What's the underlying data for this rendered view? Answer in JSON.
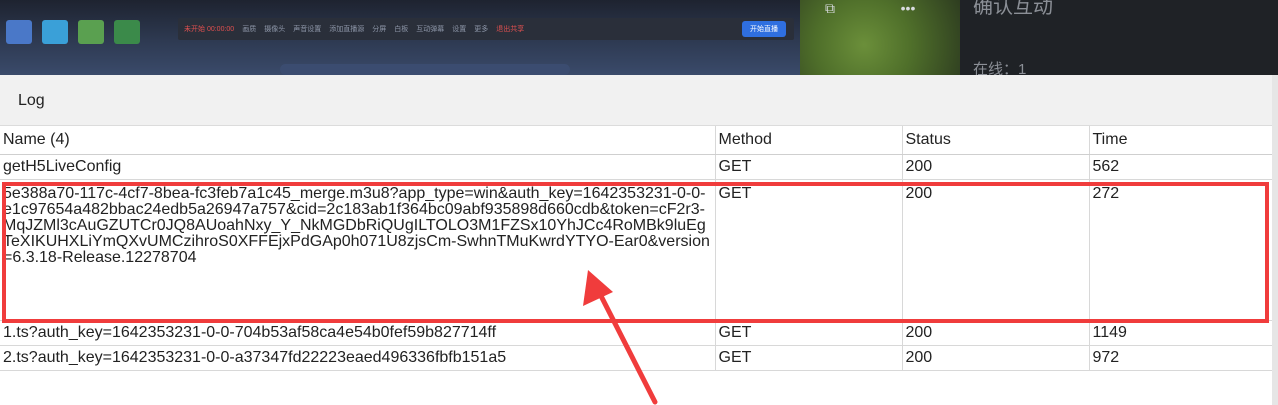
{
  "log_panel": {
    "title": "Log",
    "columns": [
      "Name (4)",
      "Method",
      "Status",
      "Time"
    ],
    "rows": [
      {
        "name": "getH5LiveConfig",
        "method": "GET",
        "status": "200",
        "time": "562"
      },
      {
        "name": "5e388a70-117c-4cf7-8bea-fc3feb7a1c45_merge.m3u8?app_type=win&auth_key=1642353231-0-0-e1c97654a482bbac24edb5a26947a757&cid=2c183ab1f364bc09abf935898d660cdb&token=cF2r3-MqJZMl3cAuGZUTCr0JQ8AUoahNxy_Y_NkMGDbRiQUgILTOLO3M1FZSx10YhJCc4RoMBk9luEgTeXIKUHXLiYmQXvUMCzihroS0XFFEjxPdGAp0h071U8zjsCm-SwhnTMuKwrdYTYO-Ear0&version=6.3.18-Release.12278704",
        "method": "GET",
        "status": "200",
        "time": "272"
      },
      {
        "name": "1.ts?auth_key=1642353231-0-0-704b53af58ca4e54b0fef59b827714ff",
        "method": "GET",
        "status": "200",
        "time": "1149"
      },
      {
        "name": "2.ts?auth_key=1642353231-0-0-a37347fd22223eaed496336fbfb151a5",
        "method": "GET",
        "status": "200",
        "time": "972"
      }
    ]
  },
  "top_strip": {
    "toolbar_items": [
      "未开始 00:00:00",
      "画质",
      "摄像头",
      "声音设置",
      "添加直播源",
      "分屏",
      "白板",
      "互动弹幕",
      "设置",
      "更多",
      "退出共享"
    ],
    "start_button": "开始直播",
    "side_panel_title": "确认互动",
    "side_panel_line": "在线：1"
  },
  "colors": {
    "highlight": "#f03c3c",
    "header_bg": "#f1f1f1"
  }
}
